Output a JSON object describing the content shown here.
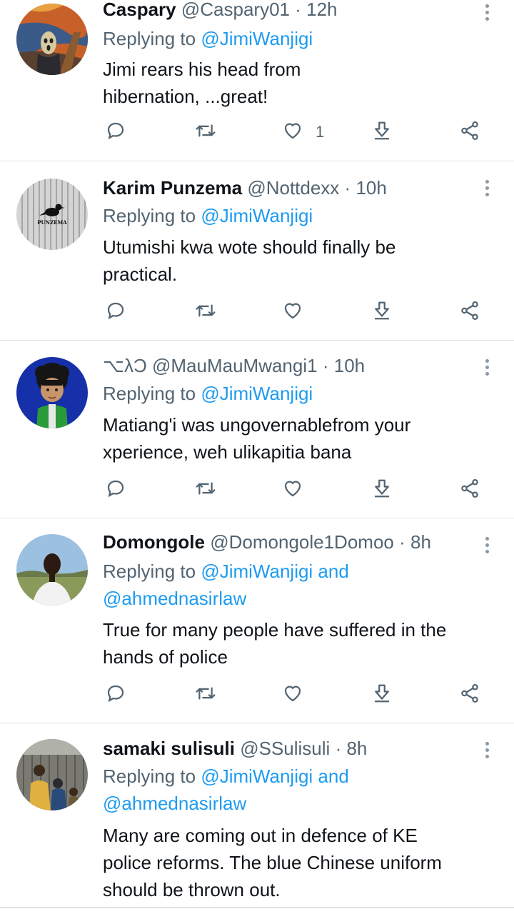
{
  "tweets": [
    {
      "name": "Caspary",
      "handle": "@Caspary01",
      "time": "12h",
      "reply_prefix": "Replying to",
      "reply_to": "@JimiWanjigi",
      "reply_to_2": "",
      "lines": [
        "Jimi rears his head from",
        "hibernation, ...great!"
      ],
      "like_count": "1",
      "avatar": "scream-painting"
    },
    {
      "name": "Karim Punzema",
      "handle": "@Nottdexx",
      "time": "10h",
      "reply_prefix": "Replying to",
      "reply_to": "@JimiWanjigi",
      "reply_to_2": "",
      "lines": [
        "Utumishi kwa wote  should finally be",
        "practical."
      ],
      "like_count": "",
      "avatar": "punzema-logo",
      "avatar_text": "PUNZEMA"
    },
    {
      "name": "⌥λƆ",
      "handle": "@MauMauMwangi1",
      "time": "10h",
      "reply_prefix": "Replying to",
      "reply_to": "@JimiWanjigi",
      "reply_to_2": "",
      "lines": [
        "Matiang'i was ungovernablefrom your",
        "xperience, weh  ulikapitia bana"
      ],
      "like_count": "",
      "avatar": "cartoon-character"
    },
    {
      "name": "Domongole",
      "handle": "@Domongole1Domoo",
      "time": "8h",
      "reply_prefix": "Replying to",
      "reply_to": "@JimiWanjigi and",
      "reply_to_2": "@ahmednasirlaw",
      "lines": [
        "True for many people have suffered in the",
        "hands of police"
      ],
      "like_count": "",
      "avatar": "person-photo"
    },
    {
      "name": "samaki sulisuli",
      "handle": "@SSulisuli",
      "time": "8h",
      "reply_prefix": "Replying to",
      "reply_to": "@JimiWanjigi and",
      "reply_to_2": "@ahmednasirlaw",
      "lines": [
        "Many are coming out in defence of KE",
        "police reforms. The blue Chinese uniform",
        "should be thrown out."
      ],
      "like_count": "",
      "avatar": "family-photo"
    }
  ],
  "separator": "·",
  "colors": {
    "link": "#1d9bf0",
    "muted": "#536471",
    "text": "#0f1419",
    "divider": "#dfe3e6"
  },
  "icons": [
    "reply-icon",
    "retweet-icon",
    "like-icon",
    "share-icon",
    "more-options-icon"
  ]
}
